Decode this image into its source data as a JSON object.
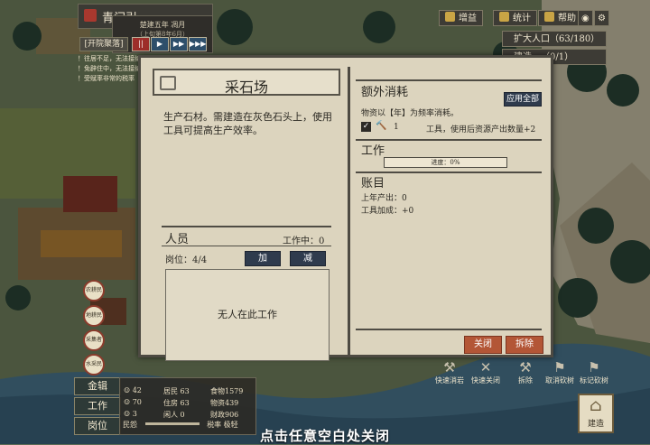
{
  "town": {
    "name": "青门引",
    "date_line1": "楚建五年 凋月",
    "date_line2": "（上旬第8年6月）",
    "season_button": "[开院聚落]"
  },
  "speed_buttons": [
    "||",
    "▶",
    "▶▶",
    "▶▶▶"
  ],
  "alerts": [
    "！往居不足，无法接纳",
    "！免辟住中，无法接纳",
    "！受赋率非常的税率"
  ],
  "toolbar": {
    "buff": "增益",
    "stats": "统计",
    "help": "帮助"
  },
  "missions": [
    "扩大人口（63/180）",
    "建造…（0/1）"
  ],
  "left_buttons": [
    "金辑",
    "工作",
    "岗位"
  ],
  "left_icons": [
    "农耕民",
    "地耕民",
    "采集者",
    "水采民"
  ],
  "stats": {
    "workers_a": "42",
    "workers_b": "70",
    "workers_c": "3",
    "residents": "居民 63",
    "housing": "住房 63",
    "idle": "闲人 0",
    "food": "食物1579",
    "goods": "物资439",
    "wealth": "财政906",
    "rate_left": "民怨",
    "rate_right": "税率 极轻"
  },
  "actions": [
    "快速消岩",
    "快速关闭",
    "拆除",
    "取消砍树",
    "标记砍树"
  ],
  "build_label": "建造",
  "close_hint": "点击任意空白处关闭",
  "dialog": {
    "title": "采石场",
    "description": "生产石材。需建造在灰色石头上，使用工具可提高生产效率。",
    "staff_label": "人员",
    "working": "工作中：0",
    "posts": "岗位：4/4",
    "add": "加",
    "remove": "减",
    "no_workers": "无人在此工作",
    "extra_title": "额外消耗",
    "apply_all": "应用全部",
    "extra_desc": "物资以【年】为频率消耗。",
    "tool_count": "1",
    "tool_desc": "工具，使用后资源产出数量+2",
    "tool_checked": true,
    "work_title": "工作",
    "progress_label": "进度：0%",
    "progress_value": 0,
    "ledger_title": "账目",
    "last_year": "上年产出：0",
    "tool_bonus": "工具加成：+0",
    "close": "关闭",
    "demolish": "拆除"
  },
  "colors": {
    "accent_red": "#b35636",
    "button_dark": "#2f3b4d",
    "paper": "#dcd4be"
  }
}
